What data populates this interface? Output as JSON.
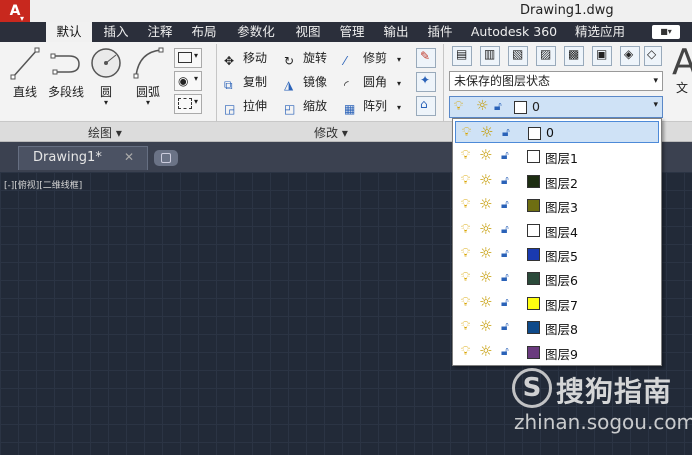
{
  "window": {
    "app_letter": "A",
    "title": "Drawing1.dwg"
  },
  "ribbon_tabs": [
    "默认",
    "插入",
    "注释",
    "布局",
    "参数化",
    "视图",
    "管理",
    "输出",
    "插件",
    "Autodesk 360",
    "精选应用"
  ],
  "draw_panel": {
    "title": "绘图 ▾",
    "tools": {
      "line": "直线",
      "polyline": "多段线",
      "circle": "圆",
      "arc": "圆弧"
    }
  },
  "modify_panel": {
    "title": "修改 ▾",
    "tools": {
      "move": "移动",
      "rotate": "旋转",
      "trim": "修剪",
      "copy": "复制",
      "mirror": "镜像",
      "fillet": "圆角",
      "stretch": "拉伸",
      "scale": "缩放",
      "array": "阵列"
    }
  },
  "layers_panel": {
    "layer_state": "未保存的图层状态",
    "current_layer": "0"
  },
  "right_edge": {
    "glyph": "A",
    "label": "文"
  },
  "document": {
    "tab_label": "Drawing1*",
    "close_glyph": "✕"
  },
  "viewport_label": "[-][俯视][二维线框]",
  "layers": [
    {
      "name": "0",
      "color": "#ffffff"
    },
    {
      "name": "图层1",
      "color": "#ffffff"
    },
    {
      "name": "图层2",
      "color": "#1d2d12"
    },
    {
      "name": "图层3",
      "color": "#6e6e12"
    },
    {
      "name": "图层4",
      "color": "#ffffff"
    },
    {
      "name": "图层5",
      "color": "#1a3ab0"
    },
    {
      "name": "图层6",
      "color": "#2b4a3a"
    },
    {
      "name": "图层7",
      "color": "#ffff10"
    },
    {
      "name": "图层8",
      "color": "#0e4a8a"
    },
    {
      "name": "图层9",
      "color": "#6a3a7e"
    }
  ],
  "watermark": {
    "logo_glyph": "S",
    "brand": "搜狗指南",
    "url": "zhinan.sogou.com"
  }
}
